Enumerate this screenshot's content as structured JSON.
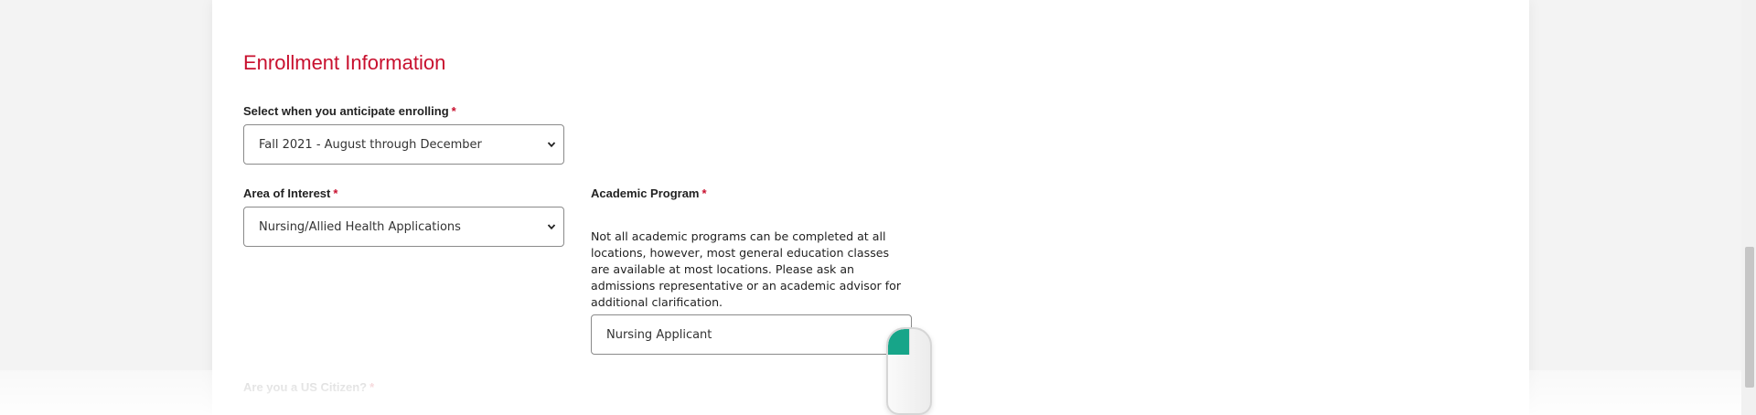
{
  "section": {
    "title": "Enrollment Information"
  },
  "fields": {
    "enrolling": {
      "label": "Select when you anticipate enrolling",
      "required_mark": "*",
      "value": "Fall 2021 - August through December"
    },
    "area_of_interest": {
      "label": "Area of Interest",
      "required_mark": "*",
      "value": "Nursing/Allied Health Applications"
    },
    "academic_program": {
      "label": "Academic Program",
      "required_mark": "*",
      "help_text": "Not all academic programs can be completed at all locations, however, most general education classes are available at most locations. Please ask an admissions representative or an academic advisor for additional clarification.",
      "value": "Nursing Applicant"
    },
    "us_citizen": {
      "label": "Are you a US Citizen?",
      "required_mark": "*"
    }
  },
  "icons": {
    "select_chevron": "chevron-down-icon",
    "mouse_overlay": "mouse-icon"
  },
  "colors": {
    "accent_red": "#c8102e",
    "mouse_button": "#17a589",
    "border": "#8a8a8a"
  },
  "overlay": {
    "mouse_button_pressed": "left"
  }
}
